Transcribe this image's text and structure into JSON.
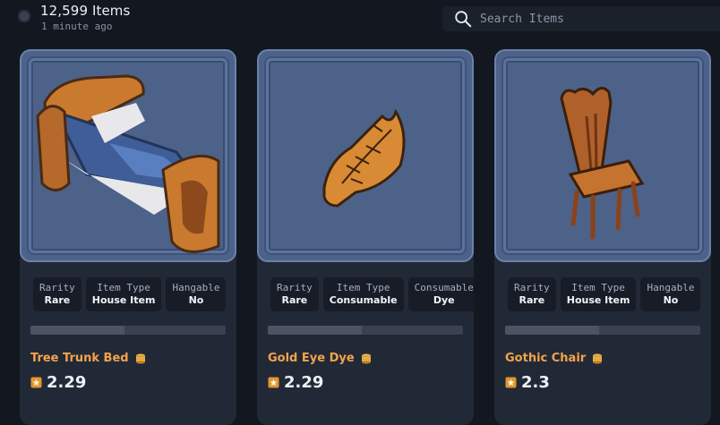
{
  "header": {
    "item_count": "12,599 Items",
    "updated": "1 minute ago"
  },
  "search": {
    "placeholder": "Search Items"
  },
  "cards": [
    {
      "name": "Tree Trunk Bed",
      "price": "2.29",
      "props": [
        {
          "key": "Rarity",
          "value": "Rare"
        },
        {
          "key": "Item Type",
          "value": "House Item"
        },
        {
          "key": "Hangable",
          "value": "No"
        }
      ],
      "bar_fraction": 0.48
    },
    {
      "name": "Gold Eye Dye",
      "price": "2.29",
      "props": [
        {
          "key": "Rarity",
          "value": "Rare"
        },
        {
          "key": "Item Type",
          "value": "Consumable"
        },
        {
          "key": "Consumable",
          "value": "Dye"
        }
      ],
      "bar_fraction": 0.48
    },
    {
      "name": "Gothic Chair",
      "price": "2.3",
      "props": [
        {
          "key": "Rarity",
          "value": "Rare"
        },
        {
          "key": "Item Type",
          "value": "House Item"
        },
        {
          "key": "Hangable",
          "value": "No"
        }
      ],
      "bar_fraction": 0.48
    }
  ],
  "colors": {
    "accent": "#f3a34c",
    "card": "#222936",
    "thumb": "#4d6288",
    "background": "#121720"
  },
  "icons": [
    "search-icon",
    "coins-icon",
    "currency-icon",
    "status-dot"
  ]
}
